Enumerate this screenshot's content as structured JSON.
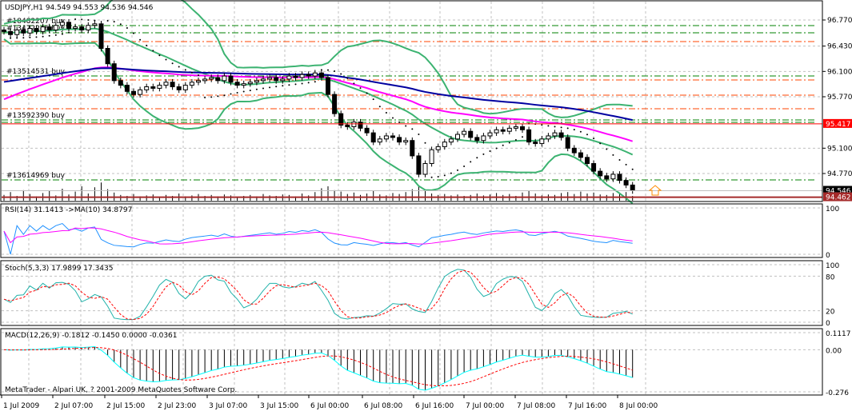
{
  "chart_data": {
    "type": "candlestick",
    "symbol_header": "USDJPY,H1  94.549 94.553 94.536 94.546",
    "price_ticks": [
      "96.770",
      "96.430",
      "96.100",
      "95.770",
      "95.100",
      "94.770"
    ],
    "price_range": [
      94.405,
      97.03
    ],
    "time_labels": [
      "1 Jul 2009",
      "2 Jul 07:00",
      "2 Jul 15:00",
      "2 Jul 23:00",
      "3 Jul 07:00",
      "3 Jul 15:00",
      "6 Jul 00:00",
      "6 Jul 08:00",
      "6 Jul 16:00",
      "7 Jul 00:00",
      "7 Jul 08:00",
      "7 Jul 16:00",
      "8 Jul 00:00"
    ],
    "closes": [
      96.62,
      96.58,
      96.64,
      96.6,
      96.66,
      96.62,
      96.68,
      96.64,
      96.7,
      96.74,
      96.66,
      96.68,
      96.64,
      96.7,
      96.72,
      96.4,
      96.2,
      95.98,
      95.92,
      95.84,
      95.8,
      95.86,
      95.9,
      95.88,
      95.92,
      95.96,
      95.9,
      95.86,
      95.92,
      95.96,
      95.98,
      96.0,
      96.02,
      95.98,
      96.04,
      95.96,
      95.92,
      95.94,
      95.96,
      95.98,
      96.0,
      96.02,
      95.98,
      96.0,
      96.04,
      96.02,
      96.06,
      96.04,
      96.08,
      96.02,
      95.8,
      95.55,
      95.4,
      95.38,
      95.44,
      95.36,
      95.3,
      95.18,
      95.22,
      95.26,
      95.24,
      95.18,
      95.2,
      95.0,
      94.76,
      94.9,
      95.08,
      95.12,
      95.18,
      95.22,
      95.28,
      95.32,
      95.24,
      95.2,
      95.26,
      95.3,
      95.34,
      95.32,
      95.36,
      95.38,
      95.34,
      95.18,
      95.16,
      95.22,
      95.26,
      95.3,
      95.24,
      95.1,
      95.04,
      94.98,
      94.9,
      94.8,
      94.74,
      94.7,
      94.76,
      94.68,
      94.62,
      94.546
    ],
    "volumes": [
      12,
      18,
      10,
      22,
      14,
      9,
      16,
      20,
      11,
      25,
      13,
      19,
      30,
      15,
      28,
      38,
      24,
      17,
      12,
      10,
      14,
      9,
      11,
      13,
      8,
      12,
      10,
      15,
      9,
      11,
      14,
      10,
      12,
      9,
      13,
      11,
      8,
      10,
      12,
      9,
      14,
      11,
      10,
      13,
      12,
      9,
      15,
      11,
      18,
      26,
      30,
      22,
      19,
      14,
      17,
      12,
      15,
      20,
      13,
      11,
      16,
      14,
      18,
      24,
      32,
      21,
      15,
      12,
      14,
      11,
      13,
      10,
      12,
      15,
      11,
      13,
      16,
      12,
      14,
      10,
      17,
      20,
      15,
      11,
      13,
      12,
      16,
      18,
      14,
      19,
      15,
      17,
      13,
      12,
      16,
      14,
      18,
      10
    ],
    "order_lines": [
      {
        "label": "#18482207 buy",
        "price": 96.697,
        "color": "#008000",
        "style": "dashdot"
      },
      {
        "label": "#13472246 buy",
        "price": 96.603,
        "color": "#008000",
        "style": "dashdot"
      },
      {
        "label": "",
        "price": 96.489,
        "color": "#ff4500",
        "style": "dashdot"
      },
      {
        "label": "#13514531 buy",
        "price": 96.041,
        "color": "#008000",
        "style": "dashdot"
      },
      {
        "label": "",
        "price": 95.989,
        "color": "#ff4500",
        "style": "dashdot"
      },
      {
        "label": "",
        "price": 95.791,
        "color": "#ff4500",
        "style": "dashdot"
      },
      {
        "label": "",
        "price": 95.614,
        "color": "#ff4500",
        "style": "dashdot"
      },
      {
        "label": "#13592390 buy",
        "price": 95.468,
        "color": "#008000",
        "style": "dashdot"
      },
      {
        "label": "",
        "price": 95.437,
        "color": "#008000",
        "style": "dashdot"
      },
      {
        "label": "#13614969 buy",
        "price": 94.687,
        "color": "#008000",
        "style": "dashdot"
      }
    ],
    "price_markers": [
      {
        "value": "95.417",
        "price": 95.417,
        "color": "#ff0000"
      },
      {
        "value": "94.546",
        "price": 94.546,
        "color": "#000000"
      },
      {
        "value": "94.462",
        "price": 94.462,
        "color": "#a52a2a"
      }
    ],
    "colors": {
      "ma_fast": "#0000a0",
      "ma_slow": "#ff00ff",
      "bands": "#3cb371",
      "bull": "#ffffff",
      "bear": "#000000",
      "grid": "#c0c0c0"
    },
    "rsi": {
      "label": "RSI(14) 31.1413  ->MA(10) 34.8797",
      "ticks": [
        "100",
        "0"
      ],
      "color": "#1e90ff",
      "ma_color": "#ff00ff"
    },
    "stoch": {
      "label": "Stoch(5,3,3) 17.9899 17.3435",
      "ticks": [
        "100",
        "80",
        "20",
        "0"
      ],
      "main_color": "#20b2aa",
      "signal_color": "#ff0000"
    },
    "macd": {
      "label": "MACD(12,26,9) -0.1812 -0.1450 0.0000 -0.0361",
      "ticks": [
        "0.1117",
        "0.00",
        "-0.276"
      ],
      "range": [
        -0.276,
        0.1117
      ],
      "line_color": "#00ffff",
      "signal_color": "#ff0000"
    },
    "footer": "MetaTrader - Alpari UK, ? 2001-2009 MetaQuotes Software Corp."
  }
}
